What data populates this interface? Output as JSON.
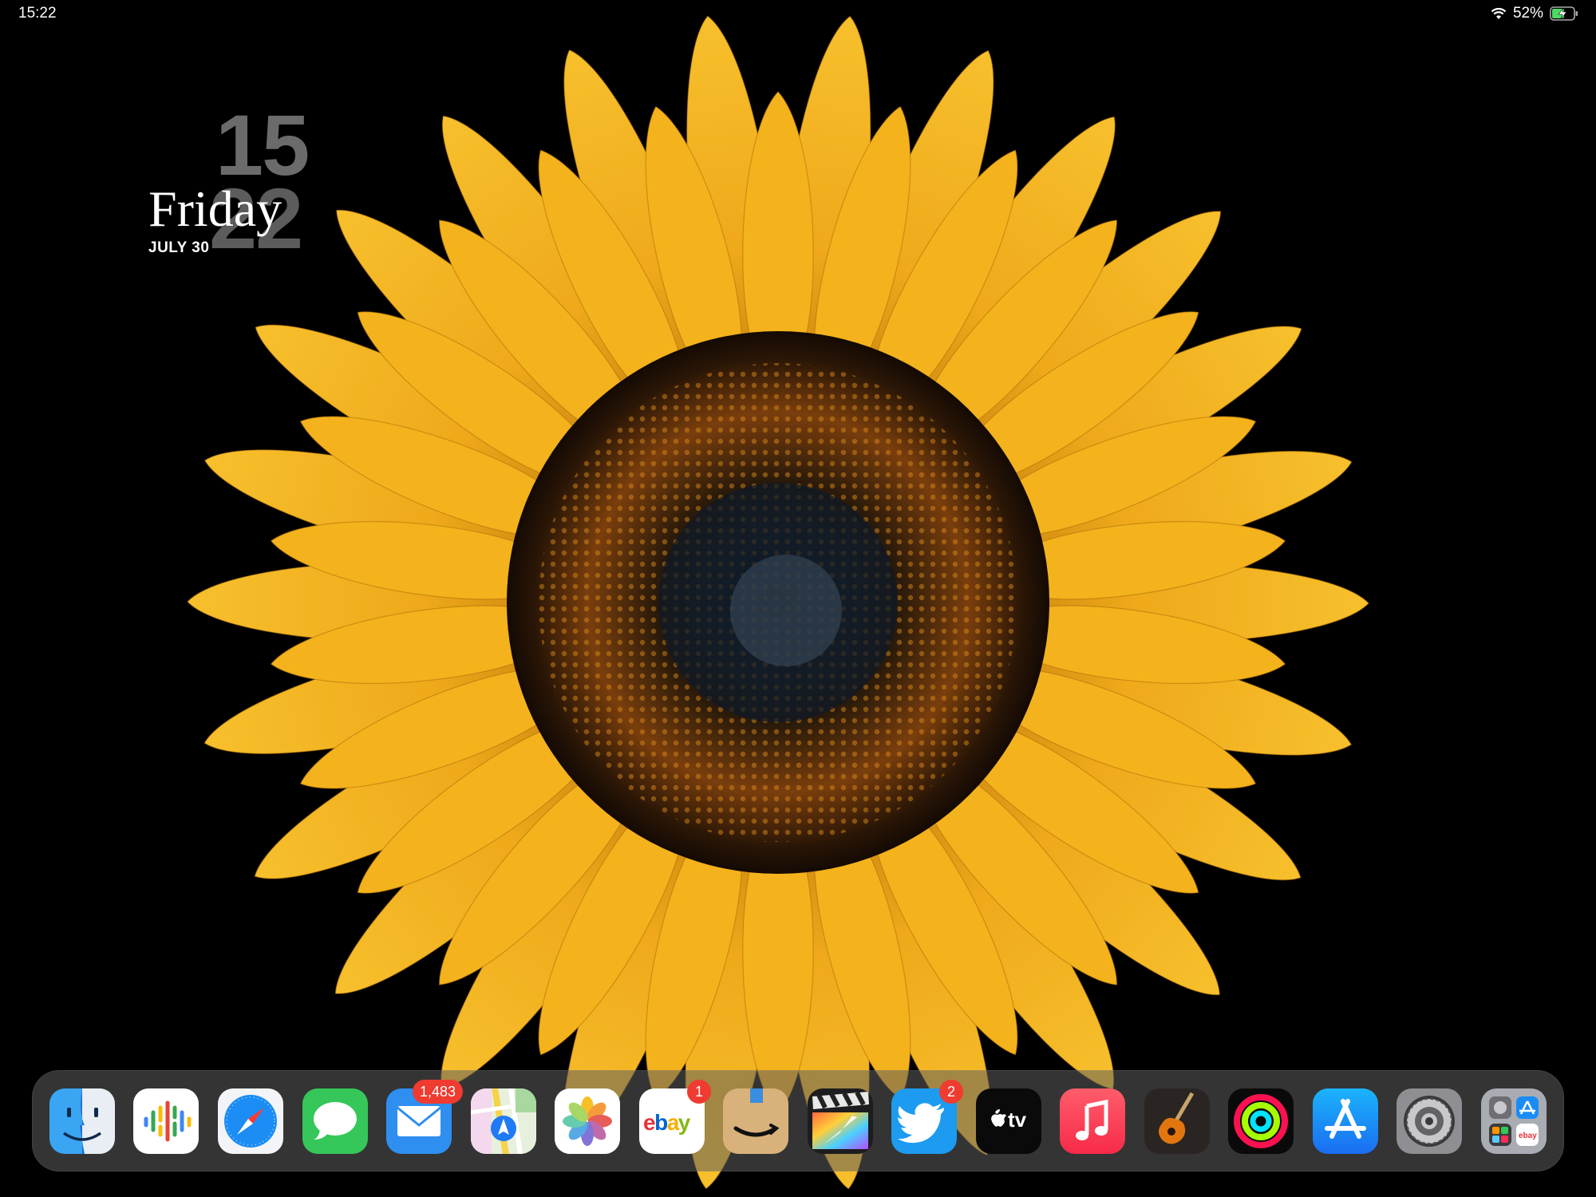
{
  "status_bar": {
    "time": "15:22",
    "battery_percent": "52%",
    "wifi": "wifi-icon",
    "battery": "battery-charging-icon"
  },
  "clock_widget": {
    "hour": "15",
    "minute": "22",
    "day": "Friday",
    "date": "JULY 30"
  },
  "wallpaper": {
    "subject": "sunflower-wallpaper",
    "petal_color": "#f4b21c",
    "background": "#000000"
  },
  "dock": {
    "apps": [
      {
        "name": "finder-icon"
      },
      {
        "name": "podcasts-icon"
      },
      {
        "name": "safari-icon"
      },
      {
        "name": "messages-icon"
      },
      {
        "name": "mail-icon",
        "badge": "1,483"
      },
      {
        "name": "maps-icon"
      },
      {
        "name": "photos-icon"
      },
      {
        "name": "ebay-icon",
        "label": "ebay",
        "badge": "1"
      },
      {
        "name": "amazon-icon"
      },
      {
        "name": "final-cut-icon"
      },
      {
        "name": "twitter-icon",
        "badge": "2"
      },
      {
        "name": "apple-tv-icon",
        "label": "tv"
      },
      {
        "name": "music-icon"
      },
      {
        "name": "garageband-icon"
      },
      {
        "name": "activity-icon"
      },
      {
        "name": "app-store-icon"
      },
      {
        "name": "settings-icon"
      },
      {
        "name": "app-library-icon",
        "label": "ebay"
      }
    ]
  }
}
